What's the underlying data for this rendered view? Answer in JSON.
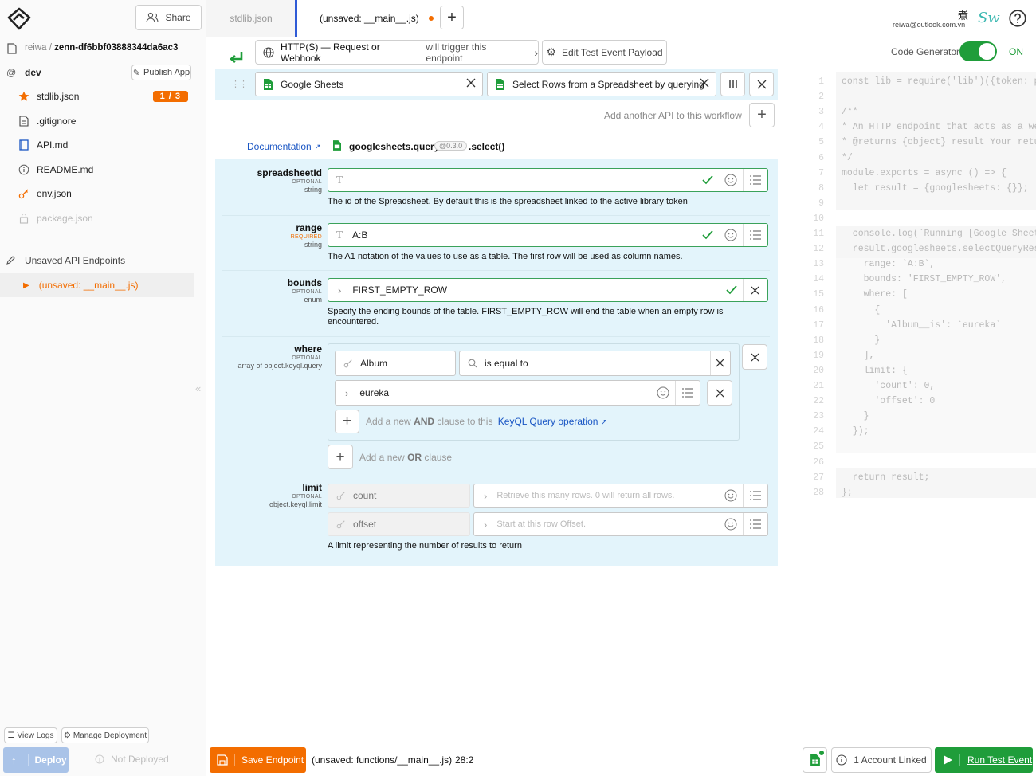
{
  "header": {
    "share_label": "Share",
    "tabs": [
      {
        "label": "stdlib.json"
      },
      {
        "label": "(unsaved: __main__.js)"
      }
    ],
    "user_email": "reiwa@outlook.com.vn",
    "user_glyph": "煮",
    "user_sig": "Sw"
  },
  "sidebar": {
    "owner": "reiwa",
    "project": "zenn-df6bbf03888344da6ac3",
    "env": "dev",
    "publish_label": "Publish App",
    "files": [
      {
        "label": "stdlib.json",
        "badge": "1 / 3",
        "icon": "star-icon"
      },
      {
        "label": ".gitignore",
        "icon": "file-icon"
      },
      {
        "label": "API.md",
        "icon": "book-icon"
      },
      {
        "label": "README.md",
        "icon": "info-icon"
      },
      {
        "label": "env.json",
        "icon": "key-icon"
      },
      {
        "label": "package.json",
        "icon": "lock-icon"
      }
    ],
    "unsaved_header": "Unsaved API Endpoints",
    "unsaved_item": "(unsaved: __main__.js)",
    "view_logs": "View Logs",
    "manage_deployment": "Manage Deployment",
    "deploy": "Deploy",
    "not_deployed": "Not Deployed"
  },
  "workflow": {
    "trigger_type": "HTTP(S) — Request or Webhook",
    "trigger_suffix": "will trigger this endpoint",
    "edit_payload": "Edit Test Event Payload",
    "code_generator": "Code Generator",
    "code_generator_state": "ON",
    "api_name": "Google Sheets",
    "method_name": "Select Rows from a Spreadsheet by querying",
    "add_api": "Add another API to this workflow",
    "documentation": "Documentation",
    "method_path": "googlesheets.query",
    "version": "@0.3.0",
    "method_suffix": ".select()"
  },
  "fields": {
    "spreadsheetId": {
      "name": "spreadsheetId",
      "req": "OPTIONAL",
      "type": "string",
      "value": "",
      "desc": "The id of the Spreadsheet. By default this is the spreadsheet linked to the active library token"
    },
    "range": {
      "name": "range",
      "req": "REQUIRED",
      "type": "string",
      "value": "A:B",
      "desc": "The A1 notation of the values to use as a table. The first row will be used as column names."
    },
    "bounds": {
      "name": "bounds",
      "req": "OPTIONAL",
      "type": "enum",
      "value": "FIRST_EMPTY_ROW",
      "desc_1": "Specify the ending bounds of the table. FIRST_EMPTY_ROW will end the table when an empty row is",
      "desc_2": "encountered."
    },
    "where": {
      "name": "where",
      "req": "OPTIONAL",
      "type": "array of object.keyql.query",
      "key": "Album",
      "operator": "is equal to",
      "value": "eureka",
      "add_and_pre": "Add a new",
      "add_and_bold": "AND",
      "add_and_post": "clause to this",
      "keyql_link": "KeyQL Query operation",
      "add_or_pre": "Add a new",
      "add_or_bold": "OR",
      "add_or_post": "clause"
    },
    "limit": {
      "name": "limit",
      "req": "OPTIONAL",
      "type": "object.keyql.limit",
      "count_label": "count",
      "count_placeholder": "Retrieve this many rows. 0 will return all rows.",
      "offset_label": "offset",
      "offset_placeholder": "Start at this row Offset.",
      "desc": "A limit representing the number of results to return"
    }
  },
  "code": [
    {
      "n": "1",
      "text": "const lib = require('lib')({token: p"
    },
    {
      "n": "2",
      "text": ""
    },
    {
      "n": "3",
      "text": "/**"
    },
    {
      "n": "4",
      "text": "* An HTTP endpoint that acts as a we"
    },
    {
      "n": "5",
      "text": "* @returns {object} result Your retu"
    },
    {
      "n": "6",
      "text": "*/"
    },
    {
      "n": "7",
      "text": "module.exports = async () => {"
    },
    {
      "n": "8",
      "text": "  let result = {googlesheets: {}};"
    },
    {
      "n": "9",
      "text": ""
    },
    {
      "n": "10",
      "text": "  "
    },
    {
      "n": "11",
      "text": "  console.log(`Running [Google Sheet"
    },
    {
      "n": "12",
      "text": "  result.googlesheets.selectQueryRes"
    },
    {
      "n": "13",
      "text": "    range: `A:B`,"
    },
    {
      "n": "14",
      "text": "    bounds: 'FIRST_EMPTY_ROW',"
    },
    {
      "n": "15",
      "text": "    where: ["
    },
    {
      "n": "16",
      "text": "      {"
    },
    {
      "n": "17",
      "text": "        'Album__is': `eureka`"
    },
    {
      "n": "18",
      "text": "      }"
    },
    {
      "n": "19",
      "text": "    ],"
    },
    {
      "n": "20",
      "text": "    limit: {"
    },
    {
      "n": "21",
      "text": "      'count': 0,"
    },
    {
      "n": "22",
      "text": "      'offset': 0"
    },
    {
      "n": "23",
      "text": "    }"
    },
    {
      "n": "24",
      "text": "  });"
    },
    {
      "n": "25",
      "text": "  "
    },
    {
      "n": "26",
      "text": ""
    },
    {
      "n": "27",
      "text": "  return result;"
    },
    {
      "n": "28",
      "text": "};"
    }
  ],
  "footer": {
    "save_label": "Save Endpoint",
    "file_path": "(unsaved: functions/__main__.js)",
    "cursor": "28:2",
    "accounts": "1 Account Linked",
    "run_label": "Run Test Event"
  },
  "colors": {
    "accent": "#f36d00",
    "green": "#1f9d3a",
    "highlight": "#e3f4fb",
    "link": "#1a56c4"
  }
}
